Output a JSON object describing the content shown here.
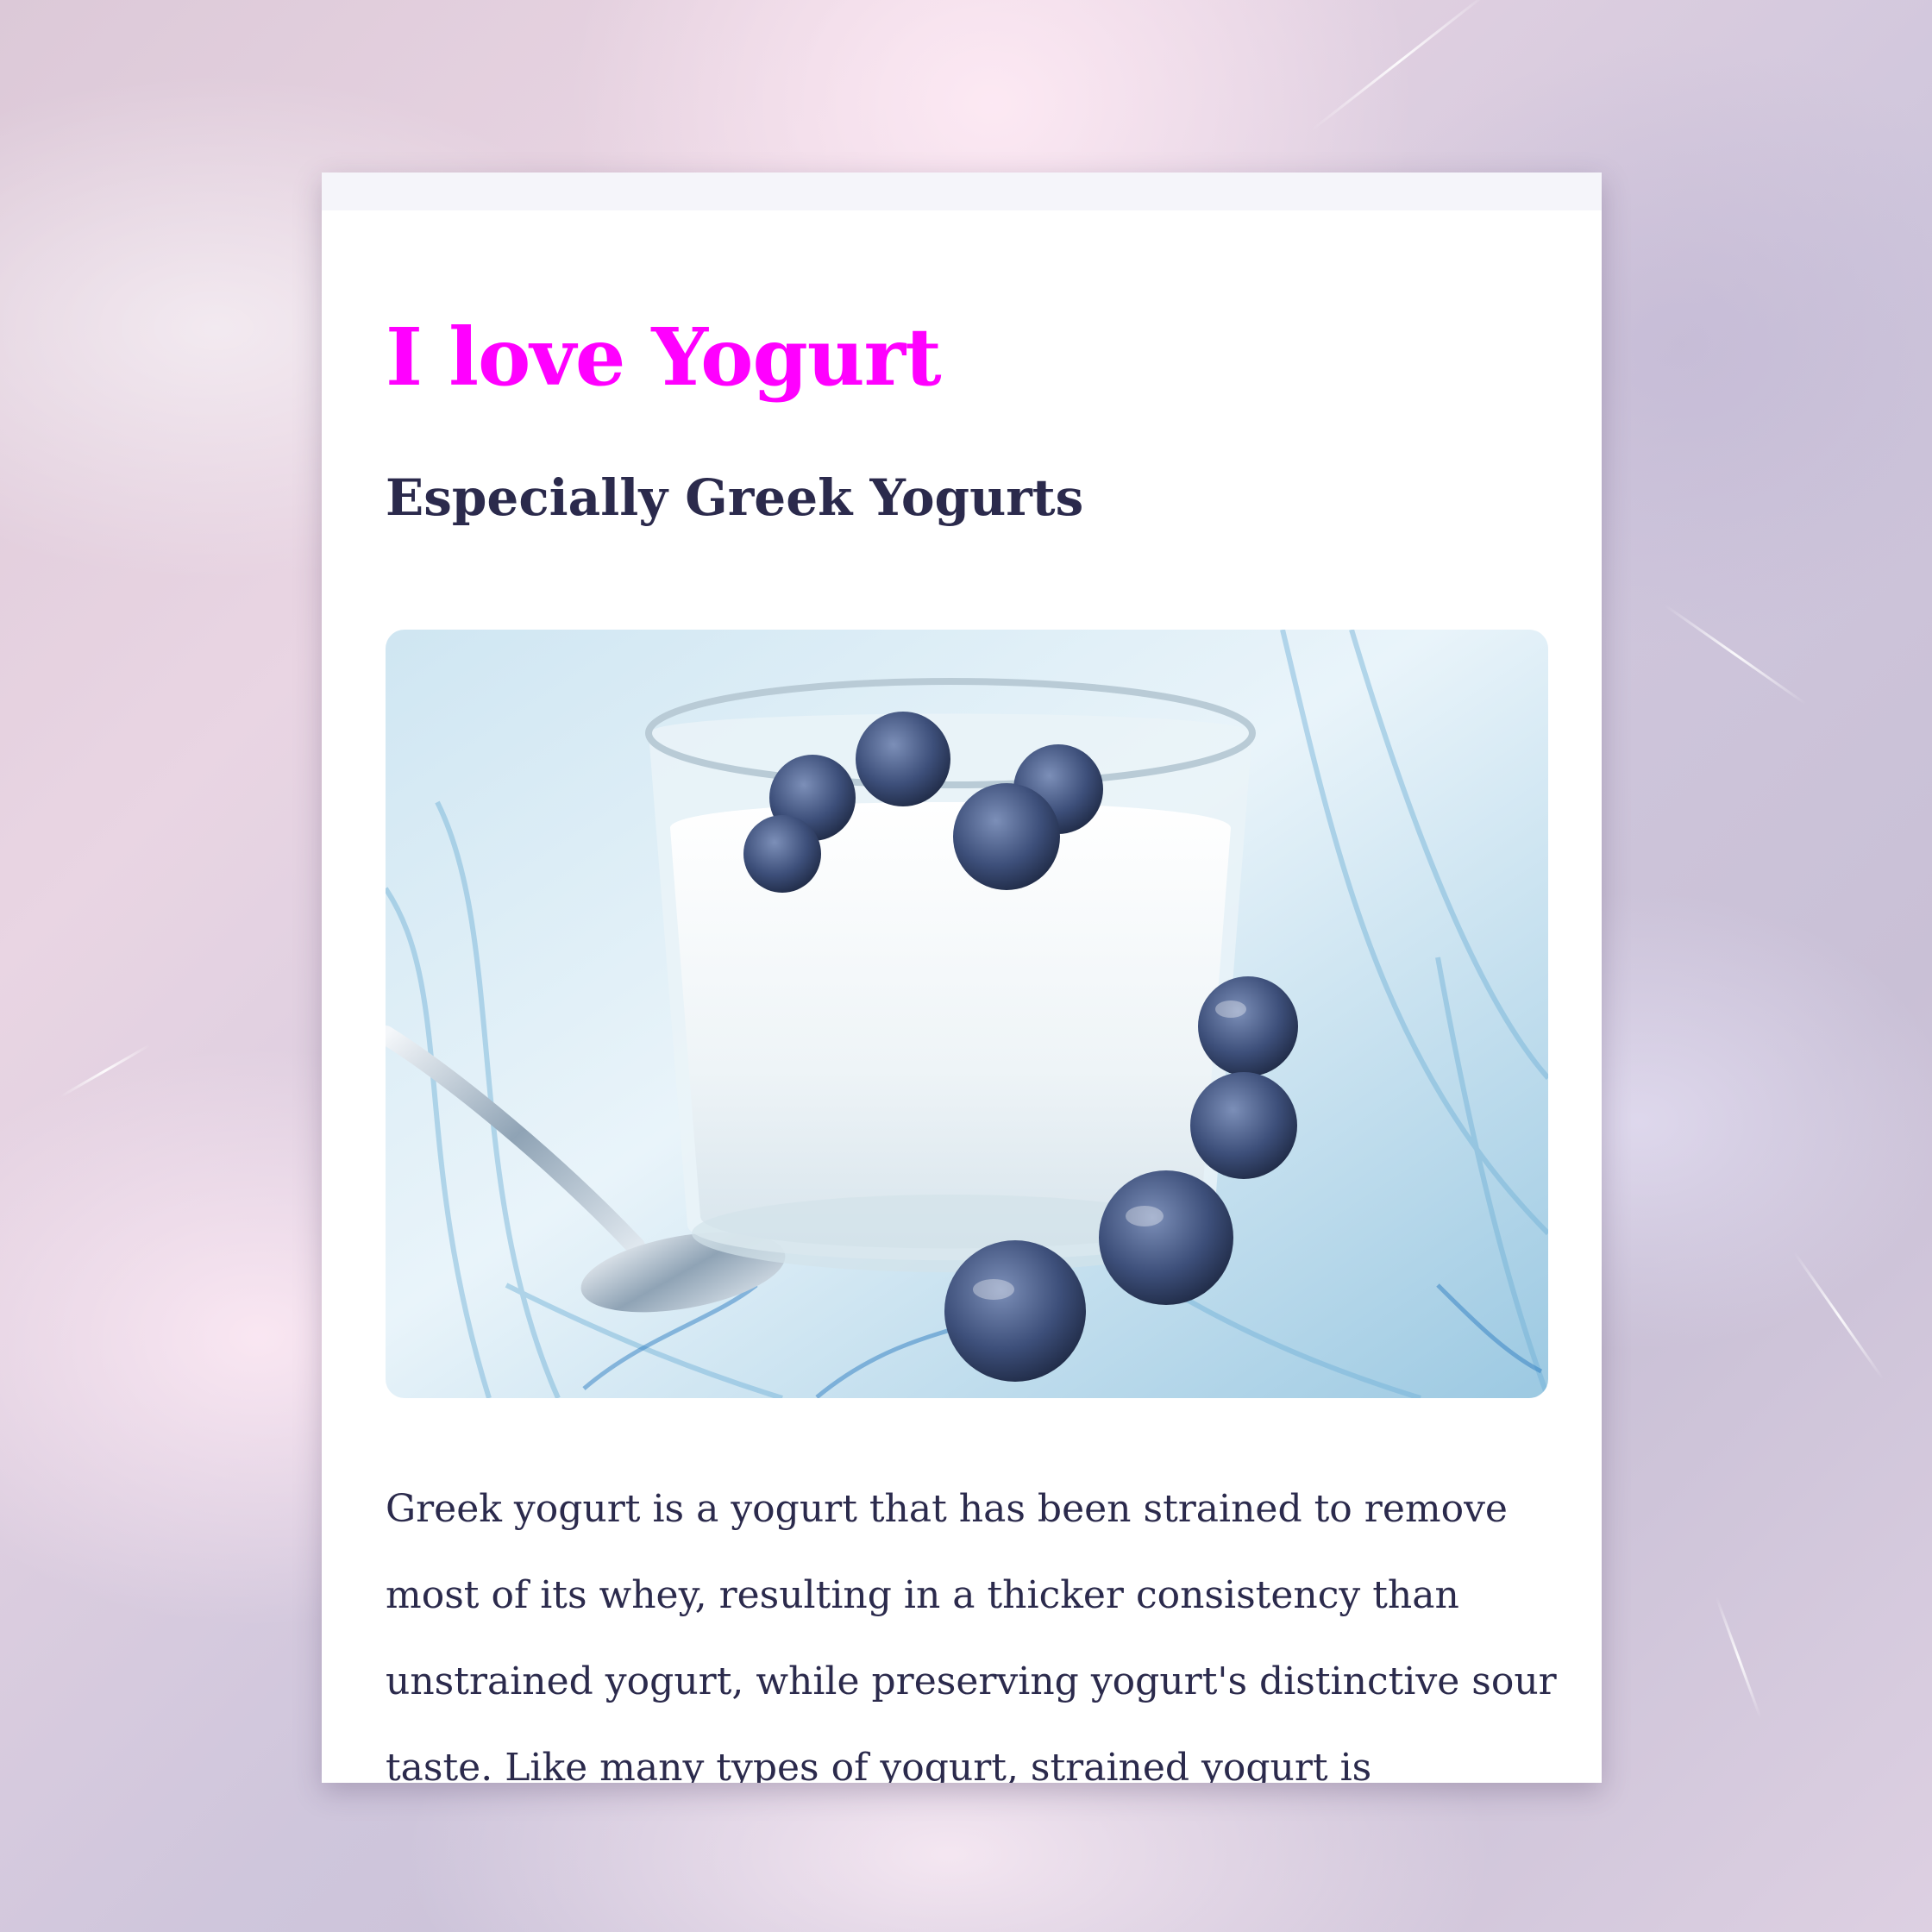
{
  "page": {
    "title": "I love Yogurt",
    "subtitle": "Especially Greek Yogurts",
    "body": "Greek yogurt is a yogurt that has been strained to remove most of its whey, resulting in a thicker consistency than unstrained yogurt, while preserving yogurt's distinctive sour taste. Like many types of yogurt, strained yogurt is"
  },
  "colors": {
    "title": "#ff00ff",
    "text": "#2b2a4c",
    "card": "#ffffff",
    "card_topbar": "#f5f5fa"
  },
  "image": {
    "subject": "glass-of-yogurt-with-blueberries-and-spoon"
  }
}
